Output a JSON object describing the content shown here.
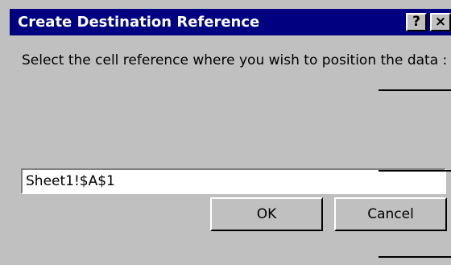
{
  "dialog": {
    "title": "Create Destination Reference",
    "help_button": "?",
    "close_button": "×",
    "prompt": "Select the cell reference where you wish to position the data :",
    "reference_value": "Sheet1!$A$1",
    "ok_label": "OK",
    "cancel_label": "Cancel"
  },
  "colors": {
    "titlebar": "#000080",
    "face": "#c0c0c0"
  }
}
